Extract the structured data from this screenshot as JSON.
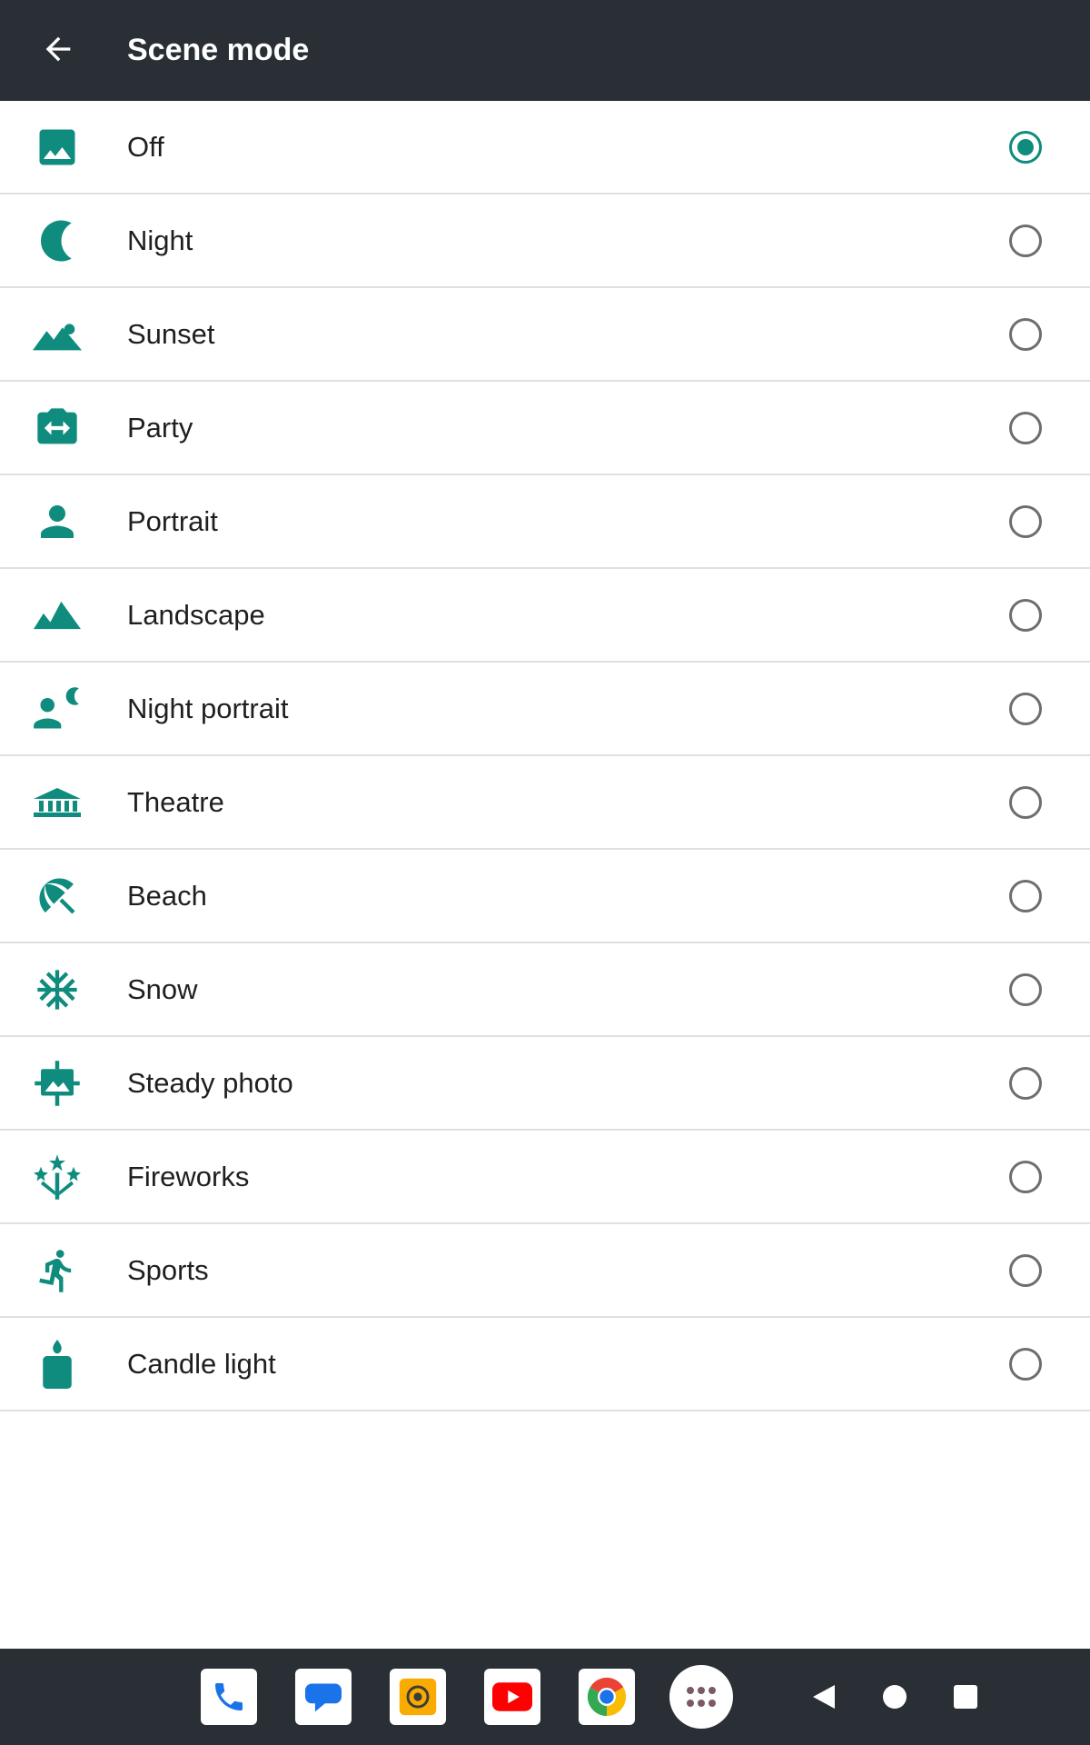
{
  "header": {
    "title": "Scene mode",
    "background": "#2a2f36"
  },
  "accent_color": "#0f8c7e",
  "scene_modes": [
    {
      "label": "Off",
      "icon": "image-icon",
      "selected": true
    },
    {
      "label": "Night",
      "icon": "moon-icon",
      "selected": false
    },
    {
      "label": "Sunset",
      "icon": "landscape-sun-icon",
      "selected": false
    },
    {
      "label": "Party",
      "icon": "camera-switch-icon",
      "selected": false
    },
    {
      "label": "Portrait",
      "icon": "person-icon",
      "selected": false
    },
    {
      "label": "Landscape",
      "icon": "mountains-icon",
      "selected": false
    },
    {
      "label": "Night portrait",
      "icon": "person-moon-icon",
      "selected": false
    },
    {
      "label": "Theatre",
      "icon": "theatre-building-icon",
      "selected": false
    },
    {
      "label": "Beach",
      "icon": "beach-umbrella-icon",
      "selected": false
    },
    {
      "label": "Snow",
      "icon": "snowflake-icon",
      "selected": false
    },
    {
      "label": "Steady photo",
      "icon": "steady-photo-icon",
      "selected": false
    },
    {
      "label": "Fireworks",
      "icon": "fireworks-icon",
      "selected": false
    },
    {
      "label": "Sports",
      "icon": "running-person-icon",
      "selected": false
    },
    {
      "label": "Candle light",
      "icon": "candle-icon",
      "selected": false
    }
  ],
  "dock": {
    "apps": [
      "phone-app-icon",
      "messages-app-icon",
      "camera-app-icon",
      "youtube-app-icon",
      "chrome-app-icon",
      "app-launcher-icon"
    ],
    "nav": [
      "back-triangle-icon",
      "home-circle-icon",
      "recents-square-icon"
    ]
  }
}
